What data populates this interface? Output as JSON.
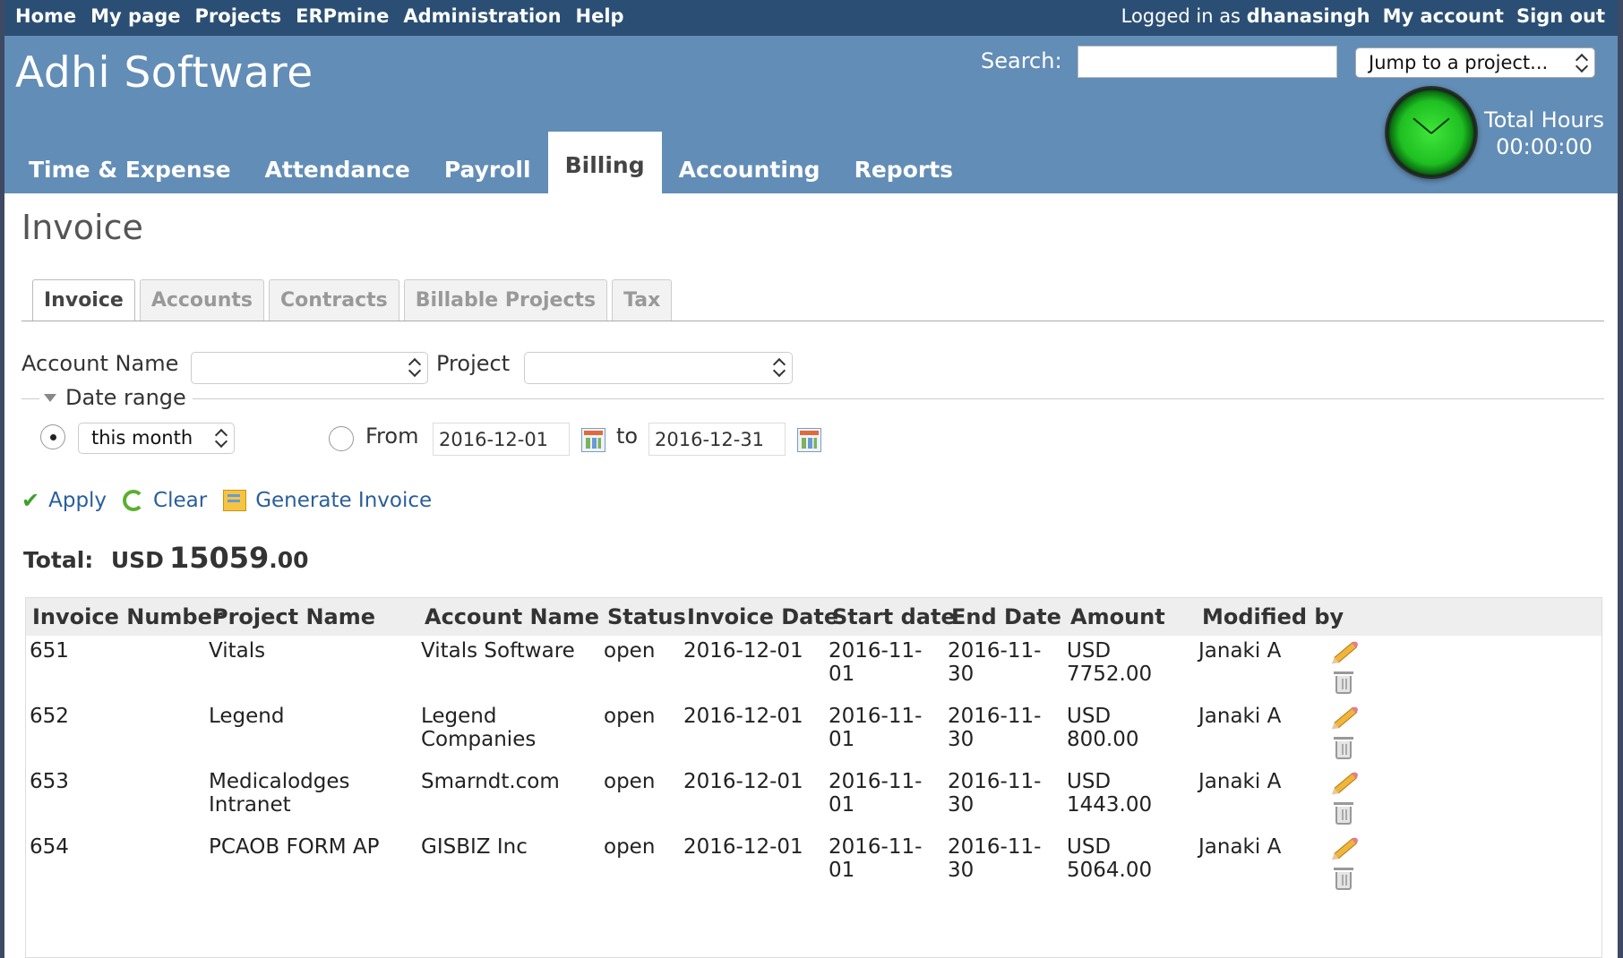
{
  "top_menu": {
    "items": [
      "Home",
      "My page",
      "Projects",
      "ERPmine",
      "Administration",
      "Help"
    ],
    "logged_in_prefix": "Logged in as",
    "username": "dhanasingh",
    "my_account": "My account",
    "sign_out": "Sign out"
  },
  "header": {
    "title": "Adhi Software",
    "search_label": "Search:",
    "search_value": "",
    "jump_select": "Jump to a project...",
    "total_hours_label": "Total Hours",
    "total_hours_value": "00:00:00"
  },
  "main_tabs": [
    {
      "label": "Time & Expense",
      "active": false
    },
    {
      "label": "Attendance",
      "active": false
    },
    {
      "label": "Payroll",
      "active": false
    },
    {
      "label": "Billing",
      "active": true
    },
    {
      "label": "Accounting",
      "active": false
    },
    {
      "label": "Reports",
      "active": false
    }
  ],
  "page_title": "Invoice",
  "sub_tabs": [
    {
      "label": "Invoice",
      "active": true
    },
    {
      "label": "Accounts",
      "active": false
    },
    {
      "label": "Contracts",
      "active": false
    },
    {
      "label": "Billable Projects",
      "active": false
    },
    {
      "label": "Tax",
      "active": false
    }
  ],
  "filters": {
    "account_name_label": "Account Name",
    "account_name_value": "",
    "project_label": "Project",
    "project_value": "",
    "date_range_legend": "Date range",
    "period_value": "this month",
    "from_label": "From",
    "from_value": "2016-12-01",
    "to_label": "to",
    "to_value": "2016-12-31"
  },
  "actions": {
    "apply": "Apply",
    "clear": "Clear",
    "generate": "Generate Invoice"
  },
  "total": {
    "label": "Total:",
    "currency": "USD",
    "integer": "15059",
    "decimal": ".00"
  },
  "table": {
    "headers": [
      "Invoice Number",
      "Project Name",
      "Account Name",
      "Status",
      "Invoice Date",
      "Start date",
      "End Date",
      "Amount",
      "Modified by"
    ],
    "rows": [
      {
        "number": "651",
        "project": [
          "Vitals"
        ],
        "account": [
          "Vitals Software"
        ],
        "status": "open",
        "invoice_date": "2016-12-01",
        "start": [
          "2016-11-",
          "01"
        ],
        "end": [
          "2016-11-",
          "30"
        ],
        "amount": [
          "USD",
          "7752.00"
        ],
        "modified_by": "Janaki A"
      },
      {
        "number": "652",
        "project": [
          "Legend"
        ],
        "account": [
          "Legend",
          "Companies"
        ],
        "status": "open",
        "invoice_date": "2016-12-01",
        "start": [
          "2016-11-",
          "01"
        ],
        "end": [
          "2016-11-",
          "30"
        ],
        "amount": [
          "USD",
          "800.00"
        ],
        "modified_by": "Janaki A"
      },
      {
        "number": "653",
        "project": [
          "Medicalodges",
          "Intranet"
        ],
        "account": [
          "Smarndt.com"
        ],
        "status": "open",
        "invoice_date": "2016-12-01",
        "start": [
          "2016-11-",
          "01"
        ],
        "end": [
          "2016-11-",
          "30"
        ],
        "amount": [
          "USD",
          "1443.00"
        ],
        "modified_by": "Janaki A"
      },
      {
        "number": "654",
        "project": [
          "PCAOB FORM AP"
        ],
        "account": [
          "GISBIZ Inc"
        ],
        "status": "open",
        "invoice_date": "2016-12-01",
        "start": [
          "2016-11-",
          "01"
        ],
        "end": [
          "2016-11-",
          "30"
        ],
        "amount": [
          "USD",
          "5064.00"
        ],
        "modified_by": "Janaki A"
      }
    ]
  },
  "icons": {
    "apply": "check-icon",
    "clear": "clear-icon",
    "generate": "generate-invoice-icon",
    "calendar": "calendar-icon",
    "edit": "pencil-icon",
    "delete": "trash-icon",
    "clock": "clock-icon"
  },
  "colors": {
    "top_bar": "#2b4f74",
    "header": "#628db6",
    "link": "#2a5e9c",
    "clock_green": "#1fbf22"
  }
}
